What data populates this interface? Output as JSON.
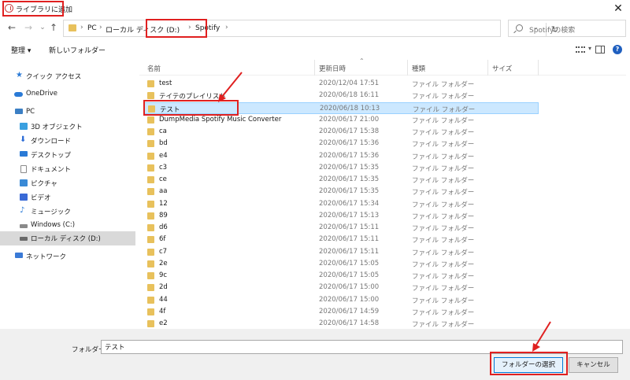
{
  "window": {
    "title": "ライブラリに追加",
    "close_glyph": "✕"
  },
  "nav": {
    "back": "←",
    "forward": "→",
    "up": "↑",
    "down": "⌄"
  },
  "address": {
    "crumbs": [
      "PC",
      "ローカル ディスク (D:)",
      "Spotify"
    ],
    "separator": "›",
    "dropdown": "⌄",
    "refresh": "↻"
  },
  "search": {
    "placeholder": "Spotifyの検索"
  },
  "toolbar": {
    "organize": "整理 ▾",
    "new_folder": "新しいフォルダー",
    "view_drop": "▾",
    "help": "?"
  },
  "sidebar": {
    "items": [
      {
        "label": "クイック アクセス",
        "icon": "star-icon",
        "color": "#2a7ad6"
      },
      {
        "label": "OneDrive",
        "icon": "cloud-icon",
        "color": "#2a7ad6"
      },
      {
        "label": "PC",
        "icon": "monitor-icon",
        "color": "#3b7fc4"
      },
      {
        "label": "3D オブジェクト",
        "icon": "cube-icon",
        "color": "#3aa0e0"
      },
      {
        "label": "ダウンロード",
        "icon": "download-icon",
        "color": "#2a6bd6"
      },
      {
        "label": "デスクトップ",
        "icon": "desktop-icon",
        "color": "#2a7ad6"
      },
      {
        "label": "ドキュメント",
        "icon": "document-icon",
        "color": "#8a8a8a"
      },
      {
        "label": "ピクチャ",
        "icon": "picture-icon",
        "color": "#3a8ad6"
      },
      {
        "label": "ビデオ",
        "icon": "video-icon",
        "color": "#3a6ad6"
      },
      {
        "label": "ミュージック",
        "icon": "music-icon",
        "color": "#2a7ad6"
      },
      {
        "label": "Windows (C:)",
        "icon": "drive-icon",
        "color": "#8a8a8a"
      },
      {
        "label": "ローカル ディスク (D:)",
        "icon": "drive-icon",
        "color": "#6a6a6a"
      },
      {
        "label": "ネットワーク",
        "icon": "network-icon",
        "color": "#3a7ad6"
      }
    ]
  },
  "columns": {
    "name": "名前",
    "date": "更新日時",
    "type": "種類",
    "size": "サイズ",
    "sort_glyph": "⌃"
  },
  "files": [
    {
      "name": "test",
      "date": "2020/12/04 17:51",
      "type": "ファイル フォルダー"
    },
    {
      "name": "テイテのプレイリスト",
      "date": "2020/06/18 16:11",
      "type": "ファイル フォルダー"
    },
    {
      "name": "テスト",
      "date": "2020/06/18 10:13",
      "type": "ファイル フォルダー"
    },
    {
      "name": "DumpMedia Spotify Music Converter",
      "date": "2020/06/17 21:00",
      "type": "ファイル フォルダー"
    },
    {
      "name": "ca",
      "date": "2020/06/17 15:38",
      "type": "ファイル フォルダー"
    },
    {
      "name": "bd",
      "date": "2020/06/17 15:36",
      "type": "ファイル フォルダー"
    },
    {
      "name": "e4",
      "date": "2020/06/17 15:36",
      "type": "ファイル フォルダー"
    },
    {
      "name": "c3",
      "date": "2020/06/17 15:35",
      "type": "ファイル フォルダー"
    },
    {
      "name": "ce",
      "date": "2020/06/17 15:35",
      "type": "ファイル フォルダー"
    },
    {
      "name": "aa",
      "date": "2020/06/17 15:35",
      "type": "ファイル フォルダー"
    },
    {
      "name": "12",
      "date": "2020/06/17 15:34",
      "type": "ファイル フォルダー"
    },
    {
      "name": "89",
      "date": "2020/06/17 15:13",
      "type": "ファイル フォルダー"
    },
    {
      "name": "d6",
      "date": "2020/06/17 15:11",
      "type": "ファイル フォルダー"
    },
    {
      "name": "6f",
      "date": "2020/06/17 15:11",
      "type": "ファイル フォルダー"
    },
    {
      "name": "c7",
      "date": "2020/06/17 15:11",
      "type": "ファイル フォルダー"
    },
    {
      "name": "2e",
      "date": "2020/06/17 15:05",
      "type": "ファイル フォルダー"
    },
    {
      "name": "9c",
      "date": "2020/06/17 15:05",
      "type": "ファイル フォルダー"
    },
    {
      "name": "2d",
      "date": "2020/06/17 15:00",
      "type": "ファイル フォルダー"
    },
    {
      "name": "44",
      "date": "2020/06/17 15:00",
      "type": "ファイル フォルダー"
    },
    {
      "name": "4f",
      "date": "2020/06/17 14:59",
      "type": "ファイル フォルダー"
    },
    {
      "name": "e2",
      "date": "2020/06/17 14:58",
      "type": "ファイル フォルダー"
    }
  ],
  "footer": {
    "folder_label": "フォルダー:",
    "folder_value": "テスト",
    "select_button": "フォルダーの選択",
    "cancel_button": "キャンセル"
  },
  "colors": {
    "annotation_red": "#e02020",
    "selection": "#cce8ff",
    "folder": "#e8c15c",
    "accent_blue": "#0078d7"
  }
}
